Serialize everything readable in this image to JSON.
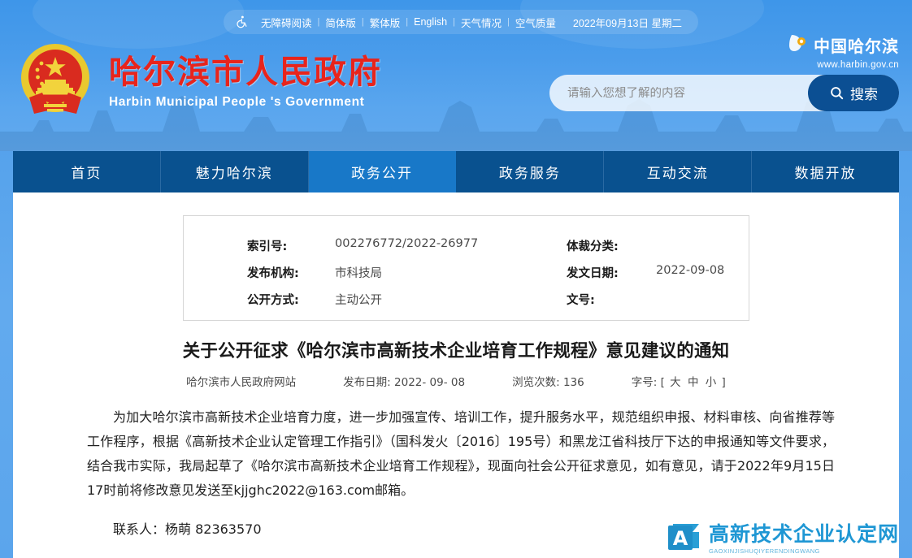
{
  "topbar": {
    "accessibility_icon": "wheelchair-icon",
    "links": [
      "无障碍阅读",
      "简体版",
      "繁体版",
      "English",
      "天气情况",
      "空气质量"
    ],
    "separator": "|",
    "datetime": "2022年09月13日 星期二"
  },
  "brand": {
    "emblem_icon": "national-emblem-icon",
    "name_cn": "哈尔滨市人民政府",
    "name_en": "Harbin Municipal People 's Government"
  },
  "gov_logo": {
    "mark_icon": "harbin-gov-mark-icon",
    "text_cn": "中国哈尔滨",
    "url": "www.harbin.gov.cn"
  },
  "search": {
    "placeholder": "请输入您想了解的内容",
    "value": "",
    "button_label": "搜索",
    "button_icon": "search-icon"
  },
  "nav": {
    "items": [
      {
        "label": "首页",
        "active": false
      },
      {
        "label": "魅力哈尔滨",
        "active": false
      },
      {
        "label": "政务公开",
        "active": true
      },
      {
        "label": "政务服务",
        "active": false
      },
      {
        "label": "互动交流",
        "active": false
      },
      {
        "label": "数据开放",
        "active": false
      }
    ]
  },
  "meta_table": {
    "rows": [
      {
        "label_left": "索引号:",
        "value_left": "002276772/2022-26977",
        "label_right": "体裁分类:",
        "value_right": ""
      },
      {
        "label_left": "发布机构:",
        "value_left": "市科技局",
        "label_right": "发文日期:",
        "value_right": "2022-09-08"
      },
      {
        "label_left": "公开方式:",
        "value_left": "主动公开",
        "label_right": "文号:",
        "value_right": ""
      }
    ]
  },
  "document": {
    "title": "关于公开征求《哈尔滨市高新技术企业培育工作规程》意见建议的通知",
    "source": "哈尔滨市人民政府网站",
    "publish_label": "发布日期:",
    "publish_date": "2022- 09- 08",
    "views_label": "浏览次数:",
    "views_count": "136",
    "fontsize_label": "字号:",
    "fontsize_open": "[",
    "fontsize_large": "大",
    "fontsize_medium": "中",
    "fontsize_small": "小",
    "fontsize_close": "]",
    "paragraphs": [
      "为加大哈尔滨市高新技术企业培育力度，进一步加强宣传、培训工作，提升服务水平，规范组织申报、材料审核、向省推荐等工作程序，根据《高新技术企业认定管理工作指引》（国科发火〔2016〕195号）和黑龙江省科技厅下达的申报通知等文件要求，结合我市实际，我局起草了《哈尔滨市高新技术企业培育工作规程》，现面向社会公开征求意见，如有意见，请于2022年9月15日17时前将修改意见发送至kjjghc2022@163.com邮箱。",
      "联系人：杨萌 82363570"
    ]
  },
  "watermark": {
    "icon": "letter-a-badge-icon",
    "text_cn": "高新技术企业认定网",
    "text_pinyin": "GAOXINJISHUQIYERENDINGWANG"
  },
  "colors": {
    "header_blue": "#3e96e9",
    "nav_blue": "#09518f",
    "nav_active_blue": "#1878c8",
    "brand_red": "#e8241c",
    "search_button": "#0b4f93",
    "watermark_blue": "#1f97d4"
  }
}
